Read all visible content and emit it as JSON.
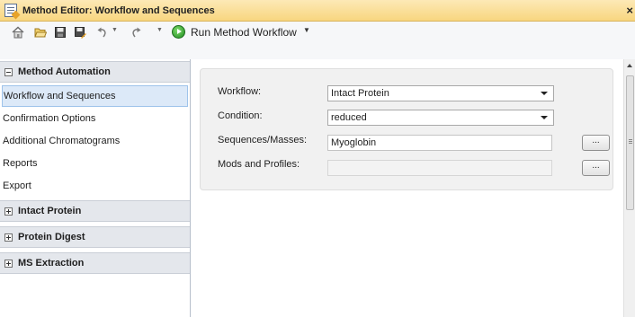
{
  "window": {
    "title": "Method Editor: Workflow and Sequences",
    "close_glyph": "×"
  },
  "toolbar": {
    "icons": [
      "home-icon",
      "folder-open-icon",
      "save-icon",
      "save-as-icon",
      "undo-icon",
      "redo-icon"
    ],
    "run_label": "Run Method Workflow",
    "run_caret": "▼"
  },
  "sidebar": {
    "sections": [
      {
        "label": "Method Automation",
        "expanded": true
      },
      {
        "label": "Intact Protein",
        "expanded": false
      },
      {
        "label": "Protein Digest",
        "expanded": false
      },
      {
        "label": "MS Extraction",
        "expanded": false
      }
    ],
    "items": [
      {
        "label": "Workflow and Sequences",
        "selected": true
      },
      {
        "label": "Confirmation Options"
      },
      {
        "label": "Additional Chromatograms"
      },
      {
        "label": "Reports"
      },
      {
        "label": "Export"
      }
    ]
  },
  "form": {
    "workflow": {
      "label": "Workflow:",
      "value": "Intact Protein"
    },
    "condition": {
      "label": "Condition:",
      "value": "reduced"
    },
    "sequences": {
      "label": "Sequences/Masses:",
      "value": "Myoglobin",
      "button": "..."
    },
    "mods": {
      "label": "Mods and Profiles:",
      "value": "",
      "button": "..."
    }
  },
  "colors": {
    "title_bar": "#f8d67f",
    "selection": "#dce9f8",
    "run_green": "#1f8a1f"
  }
}
